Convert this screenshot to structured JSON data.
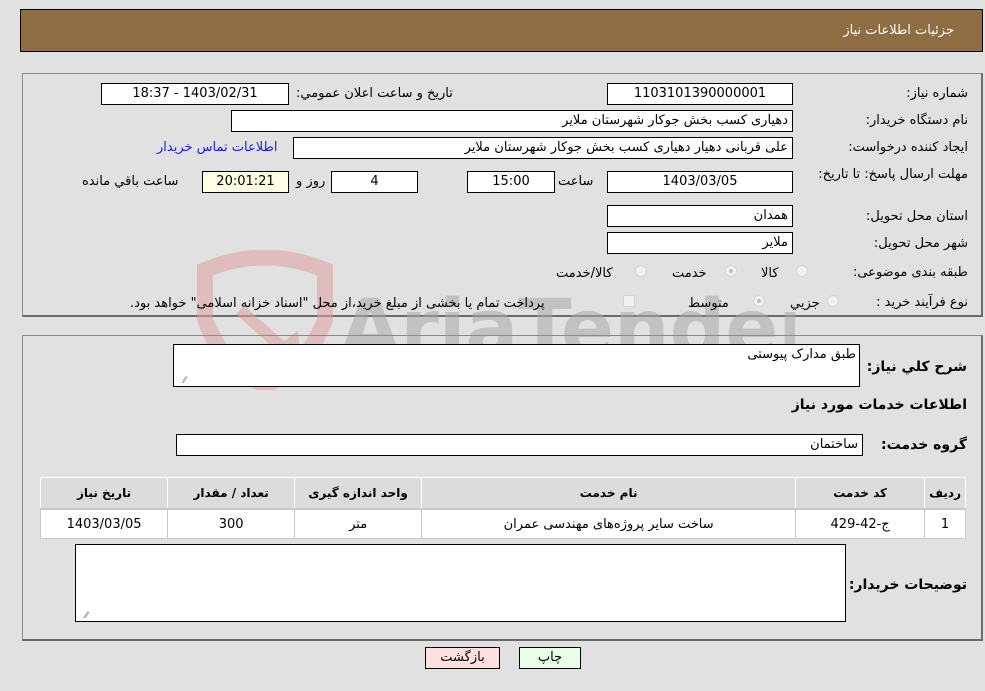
{
  "header": {
    "title": "جزئیات اطلاعات نیاز"
  },
  "details": {
    "need_number": {
      "label": "شماره نیاز:",
      "value": "1103101390000001"
    },
    "announce_datetime": {
      "label": "تاریخ و ساعت اعلان عمومي:",
      "value": "1403/02/31 - 18:37"
    },
    "buyer_org": {
      "label": "نام دستگاه خريدار:",
      "value": "دهیاری کسب بخش جوکار شهرستان ملایر"
    },
    "requester": {
      "label": "ایجاد کننده درخواست:",
      "value": "علی قربانی دهیار دهیاری کسب بخش جوکار شهرستان ملایر"
    },
    "buyer_contact_link": "اطلاعات تماس خریدار",
    "deadline": {
      "label": "مهلت ارسال پاسخ: تا تاریخ:",
      "date": "1403/03/05",
      "time_label": "ساعت",
      "time": "15:00",
      "days": "4",
      "days_label": "روز و",
      "remaining": "20:01:21",
      "remaining_label": "ساعت باقي مانده"
    },
    "province": {
      "label": "استان محل تحویل:",
      "value": "همدان"
    },
    "city": {
      "label": "شهر محل تحویل:",
      "value": "ملایر"
    },
    "category": {
      "label": "طبقه بندی موضوعی:",
      "options": [
        {
          "label": "کالا",
          "selected": false
        },
        {
          "label": "خدمت",
          "selected": true
        },
        {
          "label": "کالا/خدمت",
          "selected": false
        }
      ]
    },
    "purchase_type": {
      "label": "نوع فرآیند خرید :",
      "options": [
        {
          "label": "جزيي",
          "selected": false
        },
        {
          "label": "متوسط",
          "selected": true
        }
      ],
      "treasury_checkbox_label": "پرداخت تمام یا بخشی از مبلغ خرید،از محل \"اسناد خزانه اسلامی\" خواهد بود.",
      "treasury_checked": false
    }
  },
  "watermark": "AriaTender.neT",
  "summary": {
    "description_label": "شرح كلي نياز:",
    "description_value": "طبق مدارک پیوستی",
    "services_heading": "اطلاعات خدمات مورد نياز",
    "service_group_label": "گروه خدمت:",
    "service_group_value": "ساختمان"
  },
  "table": {
    "headers": [
      "رديف",
      "کد خدمت",
      "نام خدمت",
      "واحد اندازه گيری",
      "تعداد / مقدار",
      "تاريخ نياز"
    ],
    "rows": [
      [
        "1",
        "ج-42-429",
        "ساخت سایر پروژه‌های مهندسی عمران",
        "متر",
        "300",
        "1403/03/05"
      ]
    ]
  },
  "buyer_notes": {
    "label": "توضيحات خريدار:",
    "value": ""
  },
  "buttons": {
    "print": "چاپ",
    "back": "بازگشت"
  },
  "colors": {
    "header_bg": "#8e6d43",
    "link": "#1a1aff",
    "back_btn": "#ffe0e0",
    "print_btn": "#e8ffe8"
  }
}
